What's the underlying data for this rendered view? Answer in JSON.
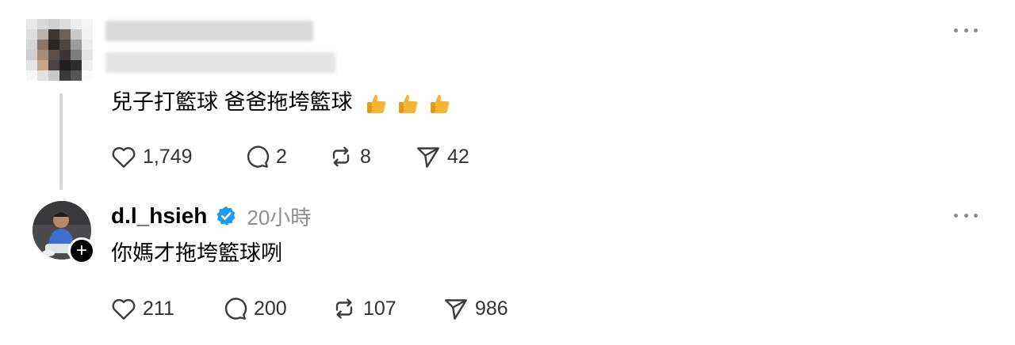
{
  "post1": {
    "text": "兒子打籃球 爸爸拖垮籃球",
    "emojis": [
      "thumbs-up-icon",
      "thumbs-up-icon",
      "thumbs-up-icon"
    ],
    "stats": {
      "likes": "1,749",
      "replies": "2",
      "reposts": "8",
      "shares": "42"
    }
  },
  "post2": {
    "username": "d.l_hsieh",
    "time": "20小時",
    "text": "你媽才拖垮籃球咧",
    "follow_symbol": "+",
    "stats": {
      "likes": "211",
      "replies": "200",
      "reposts": "107",
      "shares": "986"
    }
  },
  "colors": {
    "verified": "#1d9bf0",
    "icon": "#3c3c3c",
    "muted": "#8f8f8f",
    "emoji": "#f6b530"
  }
}
